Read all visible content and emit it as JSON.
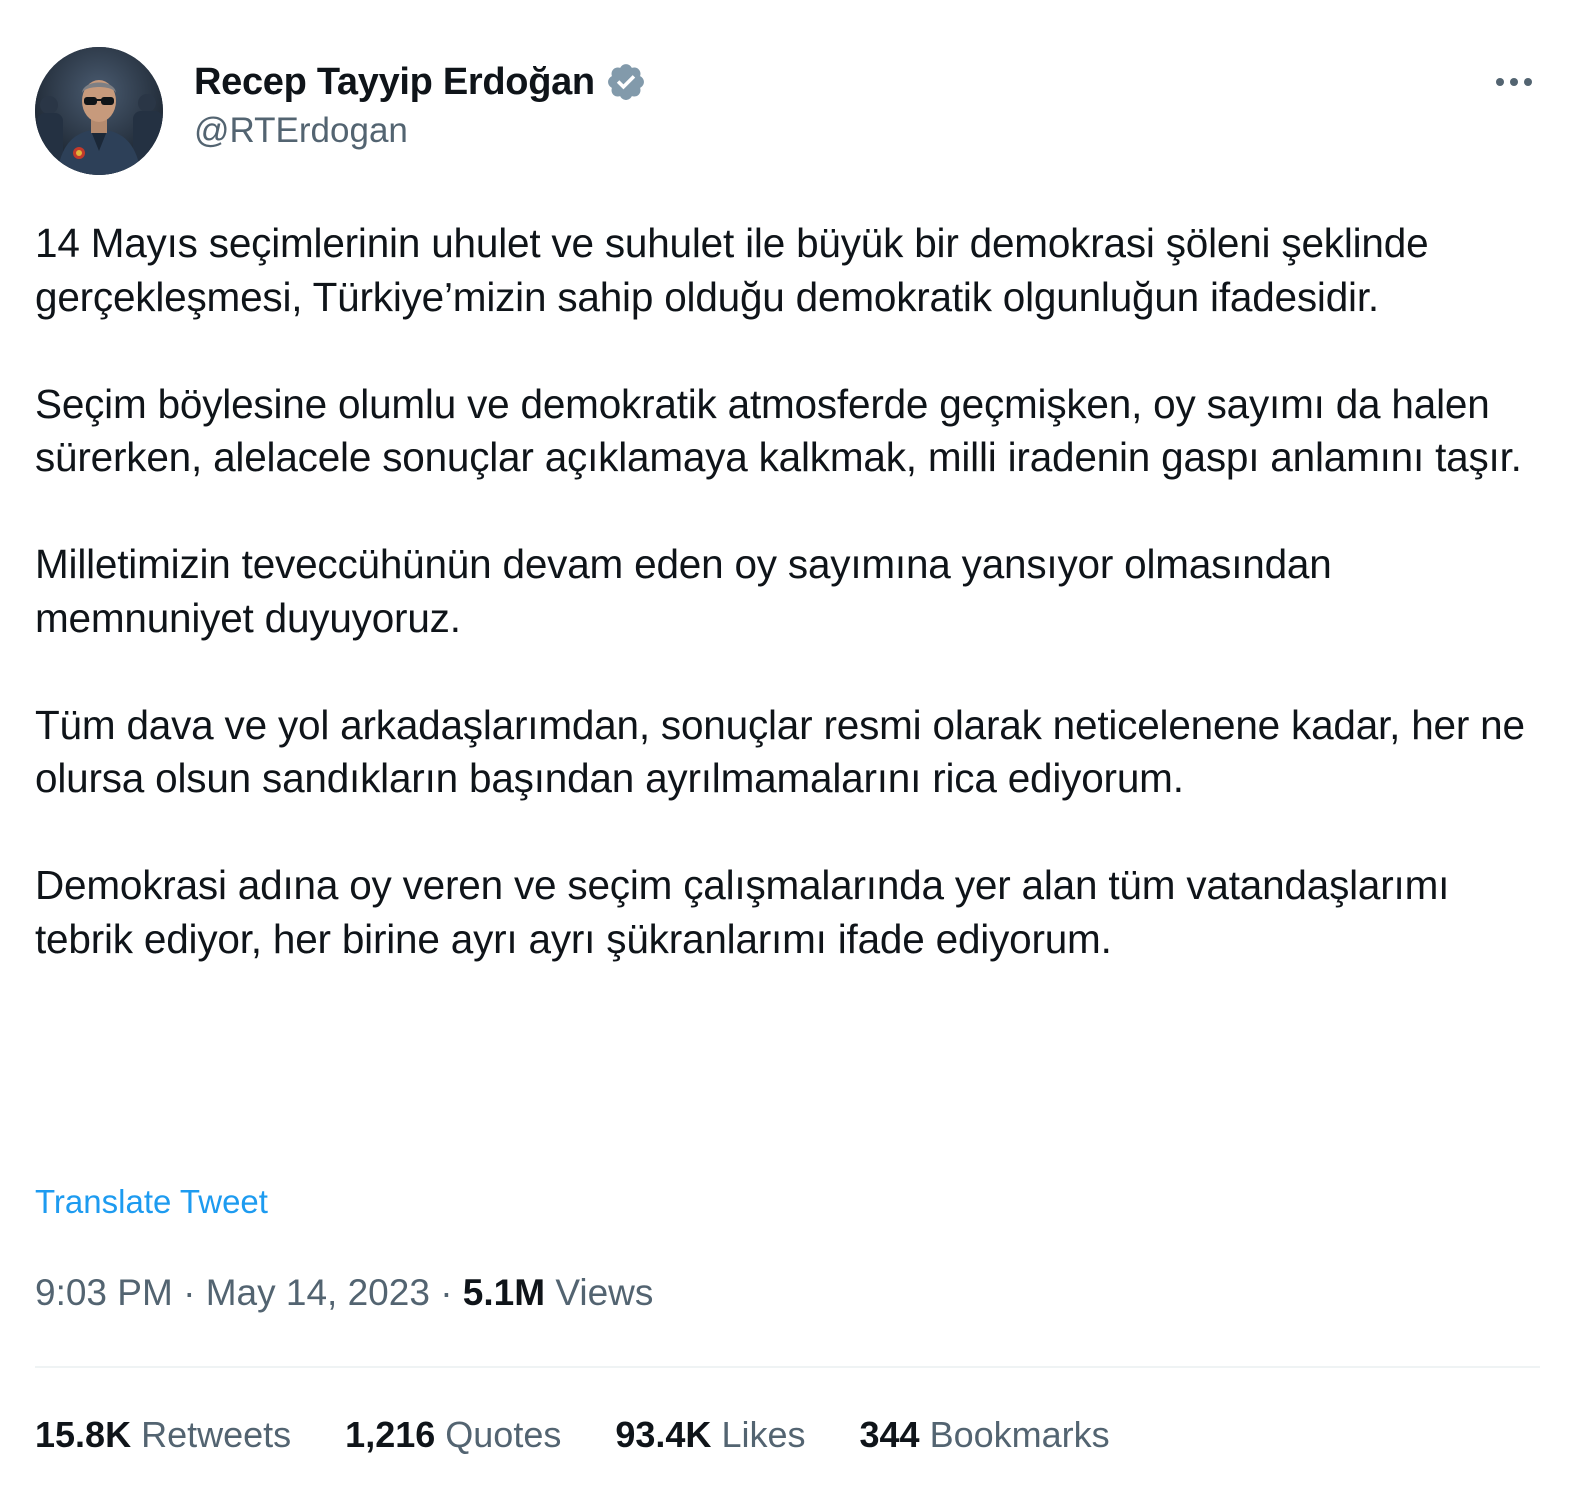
{
  "author": {
    "display_name": "Recep Tayyip Erdoğan",
    "handle": "@RTErdogan",
    "verified_color": "#829aab"
  },
  "tweet": {
    "paragraphs": [
      "14 Mayıs seçimlerinin uhulet ve suhulet ile büyük bir demokrasi şöleni şeklinde gerçekleşmesi, Türkiye’mizin sahip olduğu demokratik olgunluğun ifadesidir.",
      "Seçim böylesine olumlu ve demokratik atmosferde geçmişken, oy sayımı da halen sürerken, alelacele sonuçlar açıklamaya kalkmak, milli iradenin gaspı anlamını taşır.",
      "Milletimizin teveccühünün devam eden oy sayımına yansıyor olmasından memnuniyet duyuyoruz.",
      "Tüm dava ve yol arkadaşlarımdan, sonuçlar resmi olarak neticelenene kadar, her ne olursa olsun sandıkların başından ayrılmamalarını rica ediyorum.",
      "Demokrasi adına oy veren ve seçim çalışmalarında yer alan tüm vatandaşlarımı tebrik ediyor, her birine ayrı ayrı şükranlarımı ifade ediyorum."
    ],
    "translate_label": "Translate Tweet"
  },
  "meta": {
    "time": "9:03 PM",
    "separator": "·",
    "date": "May 14, 2023",
    "views_count": "5.1M",
    "views_label": "Views"
  },
  "stats": {
    "retweets_count": "15.8K",
    "retweets_label": "Retweets",
    "quotes_count": "1,216",
    "quotes_label": "Quotes",
    "likes_count": "93.4K",
    "likes_label": "Likes",
    "bookmarks_count": "344",
    "bookmarks_label": "Bookmarks"
  },
  "colors": {
    "text_primary": "#0f1419",
    "text_secondary": "#536471",
    "link": "#1d9bf0",
    "divider": "#eff3f4"
  },
  "icons": {
    "verified": "verified-badge-icon",
    "more": "more-options-icon"
  }
}
